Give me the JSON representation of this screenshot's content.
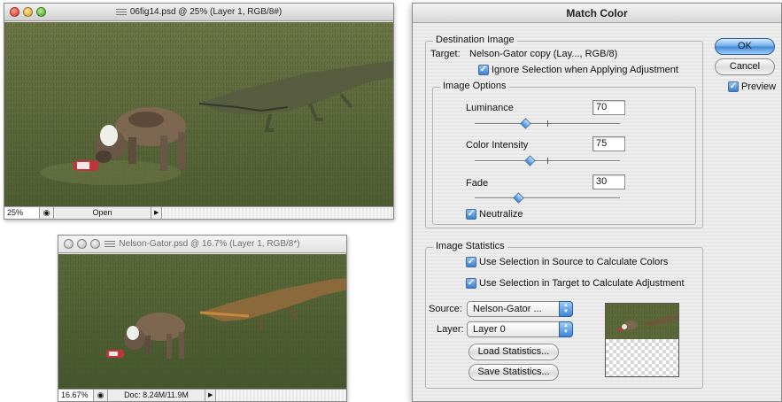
{
  "window1": {
    "title": "06fig14.psd @ 25% (Layer 1, RGB/8#)",
    "zoom": "25%",
    "info": "Open"
  },
  "window2": {
    "title": "Nelson-Gator.psd @ 16.7% (Layer 1, RGB/8*)",
    "zoom": "16.67%",
    "info": "Doc: 8.24M/11.9M"
  },
  "dialog": {
    "title": "Match Color",
    "ok_label": "OK",
    "cancel_label": "Cancel",
    "preview_label": "Preview",
    "preview_checked": true,
    "destination": {
      "group_label": "Destination Image",
      "target_label": "Target:",
      "target_value": "Nelson-Gator copy (Lay..., RGB/8)",
      "ignore_selection_label": "Ignore Selection when Applying Adjustment",
      "ignore_selection_checked": true
    },
    "image_options": {
      "group_label": "Image Options",
      "luminance_label": "Luminance",
      "luminance_value": "70",
      "luminance_fraction": 0.35,
      "intensity_label": "Color Intensity",
      "intensity_value": "75",
      "intensity_fraction": 0.375,
      "fade_label": "Fade",
      "fade_value": "30",
      "fade_fraction": 0.3,
      "neutralize_label": "Neutralize",
      "neutralize_checked": true
    },
    "statistics": {
      "group_label": "Image Statistics",
      "use_source_label": "Use Selection in Source to Calculate Colors",
      "use_source_checked": true,
      "use_target_label": "Use Selection in Target to Calculate Adjustment",
      "use_target_checked": true,
      "source_label": "Source:",
      "source_value": "Nelson-Gator ...",
      "layer_label": "Layer:",
      "layer_value": "Layer 0",
      "load_label": "Load Statistics...",
      "save_label": "Save Statistics..."
    }
  },
  "colors": {
    "grass": "#5d6a3c",
    "accent": "#3d86d6"
  },
  "icons": {
    "close": "close-icon",
    "minimize": "minimize-icon",
    "zoom": "zoom-icon",
    "checkmark": "checkmark-icon",
    "stepper": "popup-arrows-icon",
    "status_menu": "triangle-right-icon"
  }
}
